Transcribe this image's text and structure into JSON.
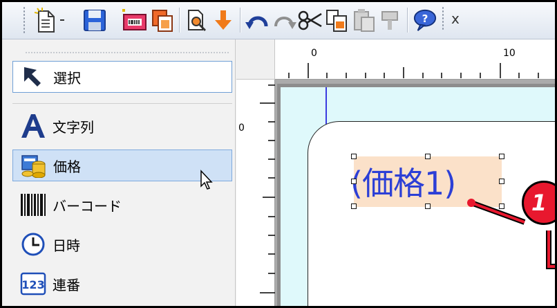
{
  "toolbar": {
    "buttons": [
      {
        "name": "new-document-icon"
      },
      {
        "name": "save-icon"
      },
      {
        "name": "print-icon"
      },
      {
        "name": "copy-page-icon"
      },
      {
        "name": "print-preview-icon"
      },
      {
        "name": "import-icon"
      },
      {
        "name": "undo-icon"
      },
      {
        "name": "redo-icon"
      },
      {
        "name": "cut-icon"
      },
      {
        "name": "copy-icon"
      },
      {
        "name": "paste-icon"
      },
      {
        "name": "help-icon"
      }
    ],
    "x_label": "x"
  },
  "tools": {
    "items": [
      {
        "id": "select",
        "label": "選択",
        "icon": "pointer-arrow-icon",
        "state": "boxed"
      },
      {
        "id": "text",
        "label": "文字列",
        "icon": "text-a-icon",
        "state": "normal"
      },
      {
        "id": "price",
        "label": "価格",
        "icon": "price-coins-icon",
        "state": "hover"
      },
      {
        "id": "barcode",
        "label": "バーコード",
        "icon": "barcode-icon",
        "state": "normal"
      },
      {
        "id": "datetime",
        "label": "日時",
        "icon": "clock-icon",
        "state": "normal"
      },
      {
        "id": "serial",
        "label": "連番",
        "icon": "number-123-icon",
        "state": "normal"
      }
    ]
  },
  "ruler": {
    "top_marks": [
      "0",
      "10"
    ],
    "left_marks": [
      "0"
    ]
  },
  "canvas": {
    "field_text": "(価格1)"
  },
  "callout": {
    "number": "1"
  },
  "colors": {
    "accent_blue": "#2c3fd6",
    "callout_red": "#e8182e",
    "selection_bg": "#cfe1f6",
    "field_fill": "#fbe1c9",
    "paper_fill": "#dff9fb"
  }
}
